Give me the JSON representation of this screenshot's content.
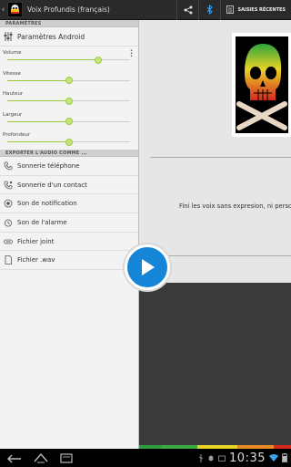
{
  "app": {
    "title": "Voix Profundis (français)",
    "recent_label": "SAISIES RÉCENTES"
  },
  "sections": {
    "params_header": "PARAMÈTRES",
    "export_header": "EXPORTER L'AUDIO COMME ..."
  },
  "android_params_label": "Paramètres Android",
  "sliders": [
    {
      "label": "Volume",
      "value": 0.74
    },
    {
      "label": "Vitesse",
      "value": 0.5
    },
    {
      "label": "Hauteur",
      "value": 0.5
    },
    {
      "label": "Largeur",
      "value": 0.5
    },
    {
      "label": "Profondeur",
      "value": 0.5
    }
  ],
  "export_items": [
    {
      "label": "Sonnerie téléphone",
      "icon": "phone-icon"
    },
    {
      "label": "Sonnerie d'un contact",
      "icon": "contact-phone-icon"
    },
    {
      "label": "Son de notification",
      "icon": "notification-icon"
    },
    {
      "label": "Son de l'alarme",
      "icon": "alarm-icon"
    },
    {
      "label": "Fichier joint",
      "icon": "attachment-icon"
    },
    {
      "label": "Fichier .wav",
      "icon": "file-icon"
    }
  ],
  "description": "Fini les voix sans expresion, ni person",
  "status": {
    "time": "10:35"
  },
  "colors": {
    "accent_green": "#9ccc45",
    "play_blue": "#1585d8"
  }
}
